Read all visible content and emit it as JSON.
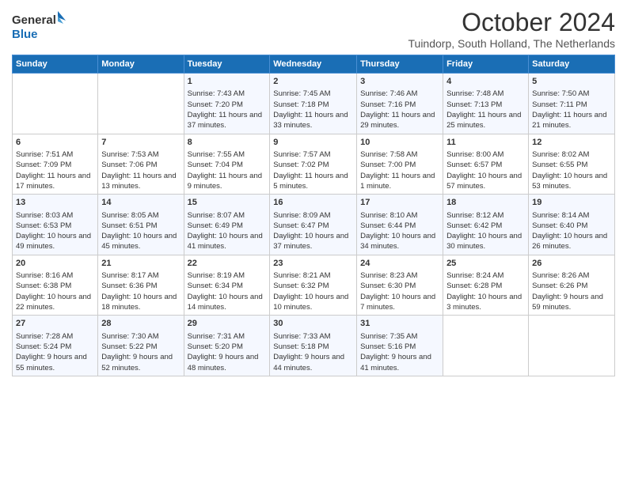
{
  "logo": {
    "line1": "General",
    "line2": "Blue"
  },
  "title": "October 2024",
  "subtitle": "Tuindorp, South Holland, The Netherlands",
  "days_of_week": [
    "Sunday",
    "Monday",
    "Tuesday",
    "Wednesday",
    "Thursday",
    "Friday",
    "Saturday"
  ],
  "weeks": [
    [
      {
        "day": "",
        "sunrise": "",
        "sunset": "",
        "daylight": ""
      },
      {
        "day": "",
        "sunrise": "",
        "sunset": "",
        "daylight": ""
      },
      {
        "day": "1",
        "sunrise": "Sunrise: 7:43 AM",
        "sunset": "Sunset: 7:20 PM",
        "daylight": "Daylight: 11 hours and 37 minutes."
      },
      {
        "day": "2",
        "sunrise": "Sunrise: 7:45 AM",
        "sunset": "Sunset: 7:18 PM",
        "daylight": "Daylight: 11 hours and 33 minutes."
      },
      {
        "day": "3",
        "sunrise": "Sunrise: 7:46 AM",
        "sunset": "Sunset: 7:16 PM",
        "daylight": "Daylight: 11 hours and 29 minutes."
      },
      {
        "day": "4",
        "sunrise": "Sunrise: 7:48 AM",
        "sunset": "Sunset: 7:13 PM",
        "daylight": "Daylight: 11 hours and 25 minutes."
      },
      {
        "day": "5",
        "sunrise": "Sunrise: 7:50 AM",
        "sunset": "Sunset: 7:11 PM",
        "daylight": "Daylight: 11 hours and 21 minutes."
      }
    ],
    [
      {
        "day": "6",
        "sunrise": "Sunrise: 7:51 AM",
        "sunset": "Sunset: 7:09 PM",
        "daylight": "Daylight: 11 hours and 17 minutes."
      },
      {
        "day": "7",
        "sunrise": "Sunrise: 7:53 AM",
        "sunset": "Sunset: 7:06 PM",
        "daylight": "Daylight: 11 hours and 13 minutes."
      },
      {
        "day": "8",
        "sunrise": "Sunrise: 7:55 AM",
        "sunset": "Sunset: 7:04 PM",
        "daylight": "Daylight: 11 hours and 9 minutes."
      },
      {
        "day": "9",
        "sunrise": "Sunrise: 7:57 AM",
        "sunset": "Sunset: 7:02 PM",
        "daylight": "Daylight: 11 hours and 5 minutes."
      },
      {
        "day": "10",
        "sunrise": "Sunrise: 7:58 AM",
        "sunset": "Sunset: 7:00 PM",
        "daylight": "Daylight: 11 hours and 1 minute."
      },
      {
        "day": "11",
        "sunrise": "Sunrise: 8:00 AM",
        "sunset": "Sunset: 6:57 PM",
        "daylight": "Daylight: 10 hours and 57 minutes."
      },
      {
        "day": "12",
        "sunrise": "Sunrise: 8:02 AM",
        "sunset": "Sunset: 6:55 PM",
        "daylight": "Daylight: 10 hours and 53 minutes."
      }
    ],
    [
      {
        "day": "13",
        "sunrise": "Sunrise: 8:03 AM",
        "sunset": "Sunset: 6:53 PM",
        "daylight": "Daylight: 10 hours and 49 minutes."
      },
      {
        "day": "14",
        "sunrise": "Sunrise: 8:05 AM",
        "sunset": "Sunset: 6:51 PM",
        "daylight": "Daylight: 10 hours and 45 minutes."
      },
      {
        "day": "15",
        "sunrise": "Sunrise: 8:07 AM",
        "sunset": "Sunset: 6:49 PM",
        "daylight": "Daylight: 10 hours and 41 minutes."
      },
      {
        "day": "16",
        "sunrise": "Sunrise: 8:09 AM",
        "sunset": "Sunset: 6:47 PM",
        "daylight": "Daylight: 10 hours and 37 minutes."
      },
      {
        "day": "17",
        "sunrise": "Sunrise: 8:10 AM",
        "sunset": "Sunset: 6:44 PM",
        "daylight": "Daylight: 10 hours and 34 minutes."
      },
      {
        "day": "18",
        "sunrise": "Sunrise: 8:12 AM",
        "sunset": "Sunset: 6:42 PM",
        "daylight": "Daylight: 10 hours and 30 minutes."
      },
      {
        "day": "19",
        "sunrise": "Sunrise: 8:14 AM",
        "sunset": "Sunset: 6:40 PM",
        "daylight": "Daylight: 10 hours and 26 minutes."
      }
    ],
    [
      {
        "day": "20",
        "sunrise": "Sunrise: 8:16 AM",
        "sunset": "Sunset: 6:38 PM",
        "daylight": "Daylight: 10 hours and 22 minutes."
      },
      {
        "day": "21",
        "sunrise": "Sunrise: 8:17 AM",
        "sunset": "Sunset: 6:36 PM",
        "daylight": "Daylight: 10 hours and 18 minutes."
      },
      {
        "day": "22",
        "sunrise": "Sunrise: 8:19 AM",
        "sunset": "Sunset: 6:34 PM",
        "daylight": "Daylight: 10 hours and 14 minutes."
      },
      {
        "day": "23",
        "sunrise": "Sunrise: 8:21 AM",
        "sunset": "Sunset: 6:32 PM",
        "daylight": "Daylight: 10 hours and 10 minutes."
      },
      {
        "day": "24",
        "sunrise": "Sunrise: 8:23 AM",
        "sunset": "Sunset: 6:30 PM",
        "daylight": "Daylight: 10 hours and 7 minutes."
      },
      {
        "day": "25",
        "sunrise": "Sunrise: 8:24 AM",
        "sunset": "Sunset: 6:28 PM",
        "daylight": "Daylight: 10 hours and 3 minutes."
      },
      {
        "day": "26",
        "sunrise": "Sunrise: 8:26 AM",
        "sunset": "Sunset: 6:26 PM",
        "daylight": "Daylight: 9 hours and 59 minutes."
      }
    ],
    [
      {
        "day": "27",
        "sunrise": "Sunrise: 7:28 AM",
        "sunset": "Sunset: 5:24 PM",
        "daylight": "Daylight: 9 hours and 55 minutes."
      },
      {
        "day": "28",
        "sunrise": "Sunrise: 7:30 AM",
        "sunset": "Sunset: 5:22 PM",
        "daylight": "Daylight: 9 hours and 52 minutes."
      },
      {
        "day": "29",
        "sunrise": "Sunrise: 7:31 AM",
        "sunset": "Sunset: 5:20 PM",
        "daylight": "Daylight: 9 hours and 48 minutes."
      },
      {
        "day": "30",
        "sunrise": "Sunrise: 7:33 AM",
        "sunset": "Sunset: 5:18 PM",
        "daylight": "Daylight: 9 hours and 44 minutes."
      },
      {
        "day": "31",
        "sunrise": "Sunrise: 7:35 AM",
        "sunset": "Sunset: 5:16 PM",
        "daylight": "Daylight: 9 hours and 41 minutes."
      },
      {
        "day": "",
        "sunrise": "",
        "sunset": "",
        "daylight": ""
      },
      {
        "day": "",
        "sunrise": "",
        "sunset": "",
        "daylight": ""
      }
    ]
  ]
}
